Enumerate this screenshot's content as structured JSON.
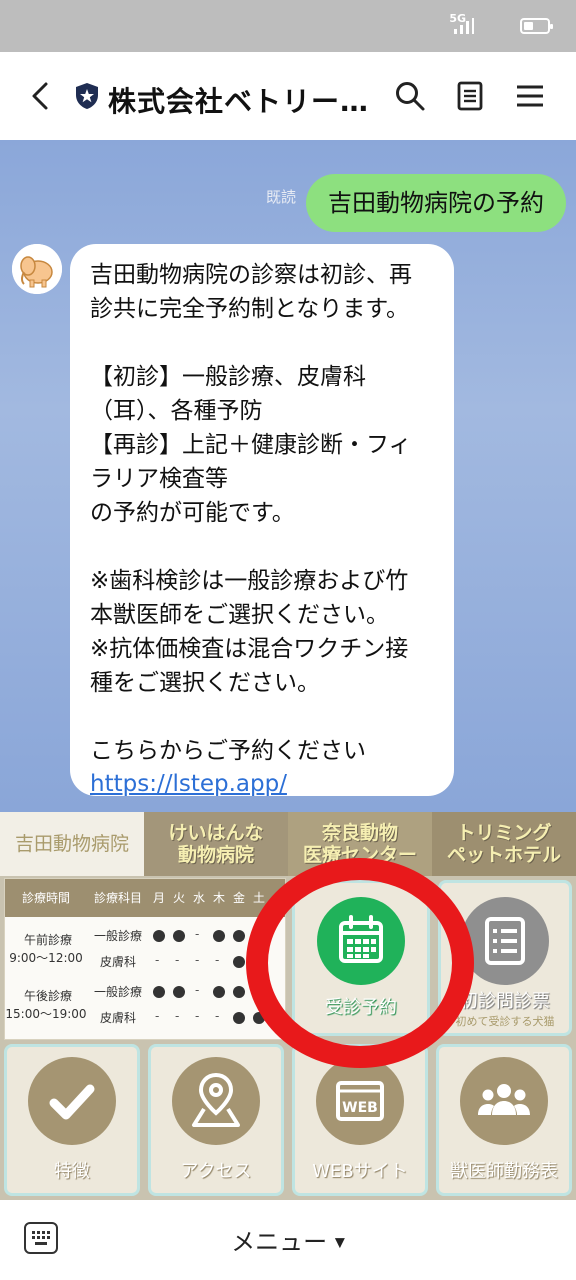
{
  "status_bar": {
    "network": "5G"
  },
  "header": {
    "title": "株式会社ベトリー…",
    "icons": [
      "back-chevron-icon",
      "shield-star-icon",
      "search-icon",
      "notes-icon",
      "menu-icon"
    ]
  },
  "chat": {
    "read_label": "既読",
    "sent_message": "吉田動物病院の予約",
    "received_lines": [
      "吉田動物病院の診察は初診、再",
      "診共に完全予約制となります。",
      "",
      "【初診】一般診療、皮膚科",
      "（耳）、各種予防",
      "【再診】上記＋健康診断・フィ",
      "ラリア検査等",
      "の予約が可能です。",
      "",
      "※歯科検診は一般診療および竹",
      "本獣医師をご選択ください。",
      "※抗体価検査は混合ワクチン接",
      "種をご選択ください。",
      "",
      "こちらからご予約ください"
    ],
    "received_link": "https://lstep.app/"
  },
  "rich_menu": {
    "tabs": [
      "吉田動物病院",
      "けいはんな動物病院",
      "奈良動物医療センター",
      "トリミングペットホテル"
    ],
    "tab_lines": [
      [
        "吉田動物病院"
      ],
      [
        "けいはんな",
        "動物病院"
      ],
      [
        "奈良動物",
        "医療センター"
      ],
      [
        "トリミング",
        "ペットホテル"
      ]
    ],
    "schedule": {
      "head_time": "診療時間",
      "head_dept": "診療科目",
      "days": [
        "月",
        "火",
        "水",
        "木",
        "金",
        "土"
      ],
      "am_label": "午前診療",
      "am_time": "9:00～12:00",
      "pm_label": "午後診療",
      "pm_time": "15:00～19:00",
      "general": "一般診療",
      "derm": "皮膚科"
    },
    "tiles": {
      "reserve": "受診予約",
      "questionnaire": "初診問診票",
      "questionnaire_sub": "初めて受診する犬猫",
      "features": "特徴",
      "access": "アクセス",
      "web": "WEBサイト",
      "web_badge": "WEB",
      "vet_schedule": "獣医師勤務表"
    },
    "colors": {
      "reserve_green": "#20b25a",
      "tan": "#a59572",
      "gray": "#8f8f8f",
      "highlight_red": "#e8191b"
    }
  },
  "bottom_bar": {
    "menu_label": "メニュー",
    "caret": "▼"
  }
}
